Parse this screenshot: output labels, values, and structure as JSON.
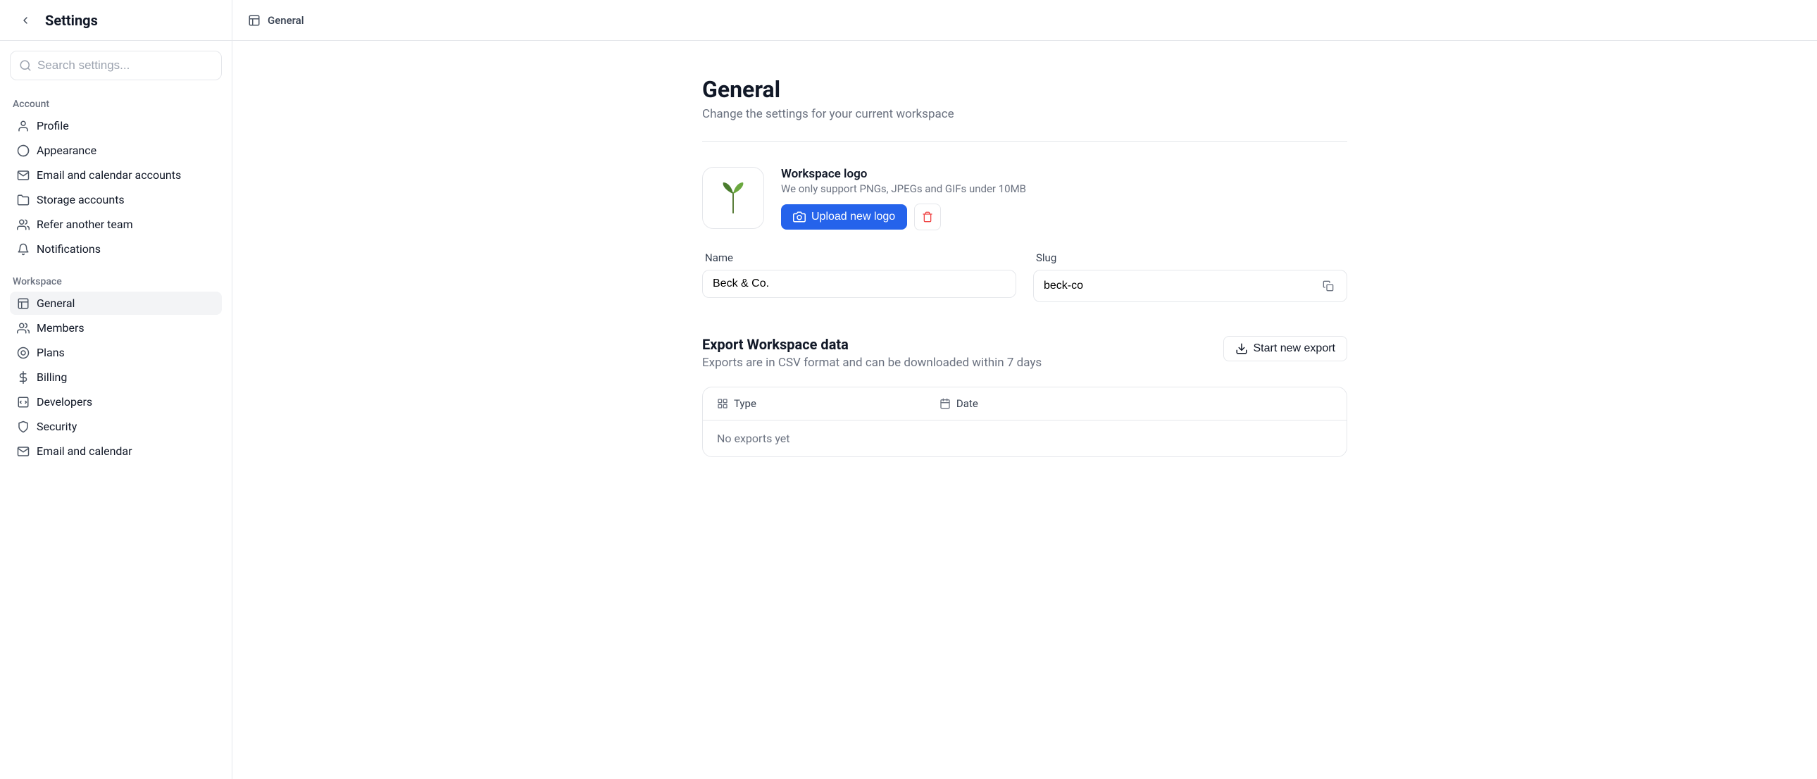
{
  "sidebar": {
    "title": "Settings",
    "search_placeholder": "Search settings...",
    "sections": [
      {
        "label": "Account",
        "items": [
          {
            "label": "Profile",
            "icon": "user-icon"
          },
          {
            "label": "Appearance",
            "icon": "palette-icon"
          },
          {
            "label": "Email and calendar accounts",
            "icon": "mail-icon"
          },
          {
            "label": "Storage accounts",
            "icon": "folder-icon"
          },
          {
            "label": "Refer another team",
            "icon": "users-icon"
          },
          {
            "label": "Notifications",
            "icon": "bell-icon"
          }
        ]
      },
      {
        "label": "Workspace",
        "items": [
          {
            "label": "General",
            "icon": "layout-icon",
            "active": true
          },
          {
            "label": "Members",
            "icon": "users-icon"
          },
          {
            "label": "Plans",
            "icon": "plan-icon"
          },
          {
            "label": "Billing",
            "icon": "dollar-icon"
          },
          {
            "label": "Developers",
            "icon": "code-icon"
          },
          {
            "label": "Security",
            "icon": "shield-icon"
          },
          {
            "label": "Email and calendar",
            "icon": "mail-icon"
          }
        ]
      }
    ]
  },
  "breadcrumb": {
    "label": "General"
  },
  "page": {
    "title": "General",
    "subtitle": "Change the settings for your current workspace"
  },
  "logo": {
    "title": "Workspace logo",
    "hint": "We only support PNGs, JPEGs and GIFs under 10MB",
    "upload_button": "Upload new logo"
  },
  "form": {
    "name_label": "Name",
    "name_value": "Beck & Co.",
    "slug_label": "Slug",
    "slug_value": "beck-co"
  },
  "export": {
    "title": "Export Workspace data",
    "subtitle": "Exports are in CSV format and can be downloaded within 7 days",
    "button": "Start new export",
    "columns": {
      "type": "Type",
      "date": "Date"
    },
    "empty": "No exports yet"
  }
}
